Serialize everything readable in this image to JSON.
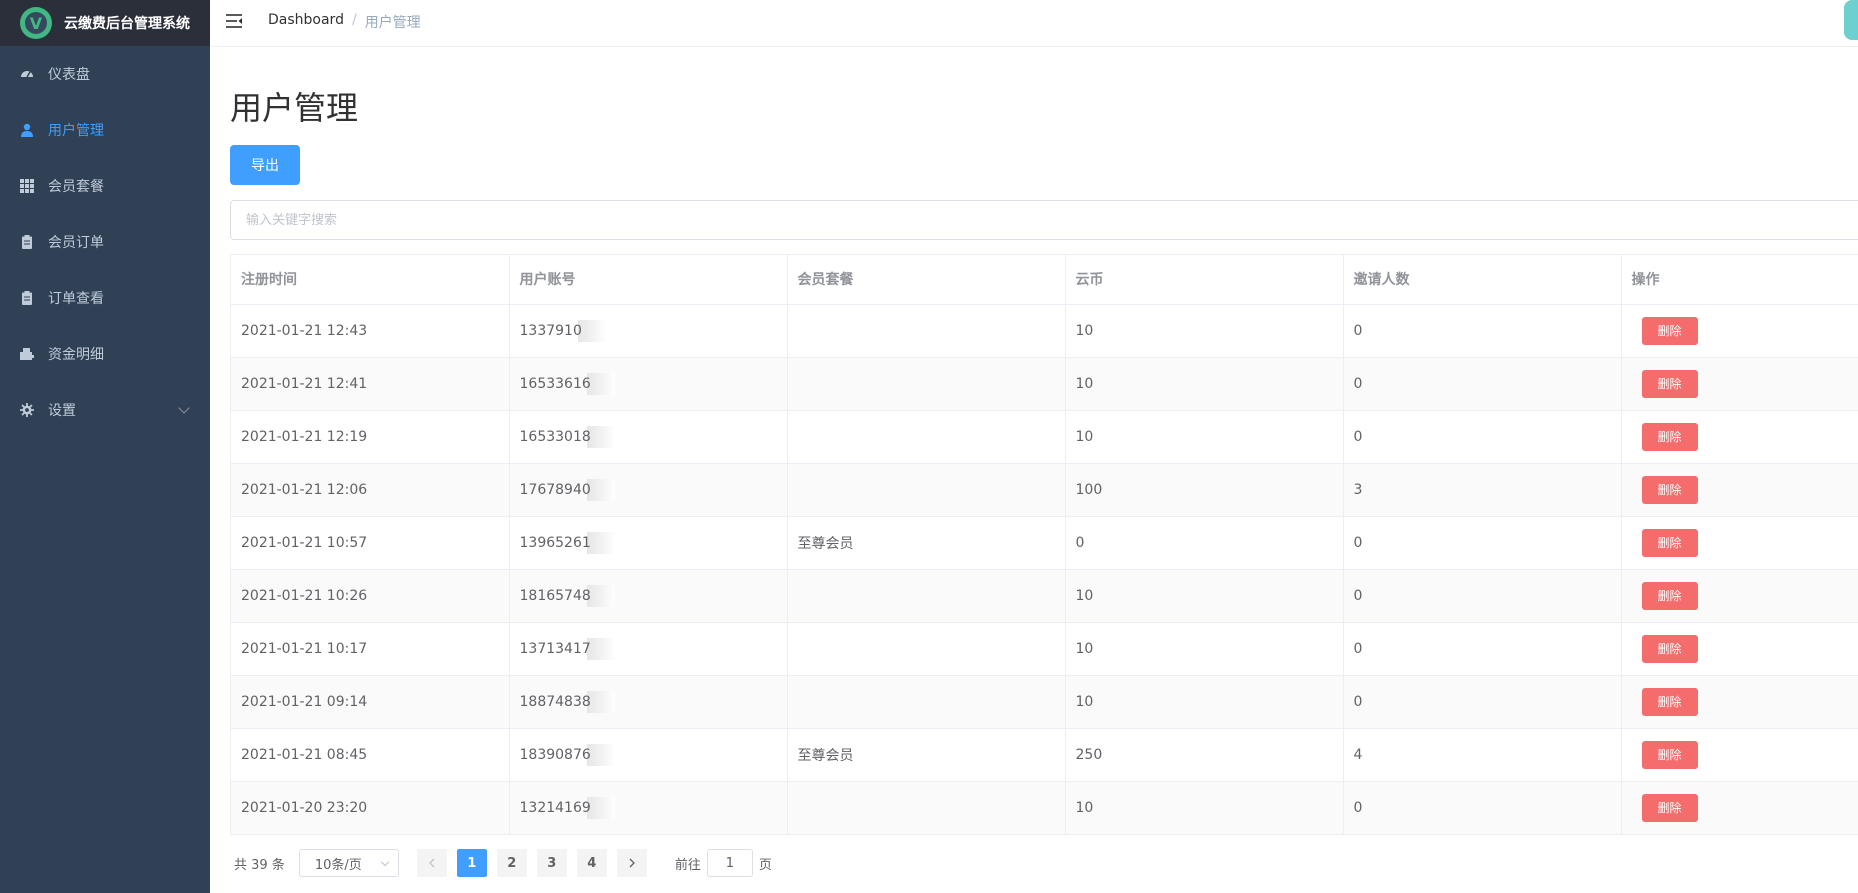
{
  "app": {
    "title": "云缴费后台管理系统",
    "logo_letter": "V"
  },
  "sidebar": {
    "items": [
      {
        "label": "仪表盘",
        "icon": "dashboard-icon",
        "active": false
      },
      {
        "label": "用户管理",
        "icon": "user-icon",
        "active": true
      },
      {
        "label": "会员套餐",
        "icon": "grid-icon",
        "active": false
      },
      {
        "label": "会员订单",
        "icon": "clipboard-icon",
        "active": false
      },
      {
        "label": "订单查看",
        "icon": "clipboard-icon",
        "active": false
      },
      {
        "label": "资金明细",
        "icon": "wallet-icon",
        "active": false
      },
      {
        "label": "设置",
        "icon": "gear-icon",
        "active": false,
        "has_submenu": true
      }
    ]
  },
  "header": {
    "breadcrumb": {
      "home": "Dashboard",
      "separator": "/",
      "current": "用户管理"
    }
  },
  "main": {
    "title": "用户管理",
    "export_label": "导出",
    "search": {
      "placeholder": "输入关键字搜索",
      "value": ""
    },
    "table": {
      "headers": [
        "注册时间",
        "用户账号",
        "会员套餐",
        "云币",
        "邀请人数",
        "操作"
      ],
      "delete_label": "删除",
      "rows": [
        {
          "time": "2021-01-21 12:43",
          "account": "1337910",
          "plan": "",
          "coins": "10",
          "invites": "0"
        },
        {
          "time": "2021-01-21 12:41",
          "account": "16533616",
          "plan": "",
          "coins": "10",
          "invites": "0"
        },
        {
          "time": "2021-01-21 12:19",
          "account": "16533018",
          "plan": "",
          "coins": "10",
          "invites": "0"
        },
        {
          "time": "2021-01-21 12:06",
          "account": "17678940",
          "plan": "",
          "coins": "100",
          "invites": "3"
        },
        {
          "time": "2021-01-21 10:57",
          "account": "13965261",
          "plan": "至尊会员",
          "coins": "0",
          "invites": "0"
        },
        {
          "time": "2021-01-21 10:26",
          "account": "18165748",
          "plan": "",
          "coins": "10",
          "invites": "0"
        },
        {
          "time": "2021-01-21 10:17",
          "account": "13713417",
          "plan": "",
          "coins": "10",
          "invites": "0"
        },
        {
          "time": "2021-01-21 09:14",
          "account": "18874838",
          "plan": "",
          "coins": "10",
          "invites": "0"
        },
        {
          "time": "2021-01-21 08:45",
          "account": "18390876",
          "plan": "至尊会员",
          "coins": "250",
          "invites": "4"
        },
        {
          "time": "2021-01-20 23:20",
          "account": "13214169",
          "plan": "",
          "coins": "10",
          "invites": "0"
        }
      ]
    },
    "pagination": {
      "total_text": "共 39 条",
      "page_size": "10条/页",
      "pages": [
        "1",
        "2",
        "3",
        "4"
      ],
      "current_page": "1",
      "goto_prefix": "前往",
      "goto_value": "1",
      "goto_suffix": "页"
    }
  },
  "colors": {
    "sidebar_bg": "#304156",
    "accent": "#409eff",
    "danger": "#f56c6c"
  }
}
